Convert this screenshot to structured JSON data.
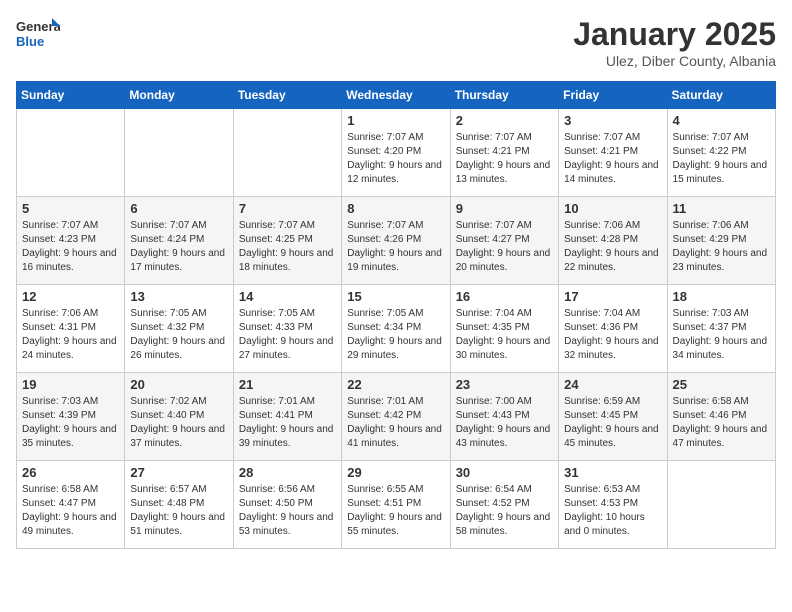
{
  "header": {
    "logo_general": "General",
    "logo_blue": "Blue",
    "month": "January 2025",
    "location": "Ulez, Diber County, Albania"
  },
  "weekdays": [
    "Sunday",
    "Monday",
    "Tuesday",
    "Wednesday",
    "Thursday",
    "Friday",
    "Saturday"
  ],
  "weeks": [
    [
      {
        "day": "",
        "info": ""
      },
      {
        "day": "",
        "info": ""
      },
      {
        "day": "",
        "info": ""
      },
      {
        "day": "1",
        "info": "Sunrise: 7:07 AM\nSunset: 4:20 PM\nDaylight: 9 hours and 12 minutes."
      },
      {
        "day": "2",
        "info": "Sunrise: 7:07 AM\nSunset: 4:21 PM\nDaylight: 9 hours and 13 minutes."
      },
      {
        "day": "3",
        "info": "Sunrise: 7:07 AM\nSunset: 4:21 PM\nDaylight: 9 hours and 14 minutes."
      },
      {
        "day": "4",
        "info": "Sunrise: 7:07 AM\nSunset: 4:22 PM\nDaylight: 9 hours and 15 minutes."
      }
    ],
    [
      {
        "day": "5",
        "info": "Sunrise: 7:07 AM\nSunset: 4:23 PM\nDaylight: 9 hours and 16 minutes."
      },
      {
        "day": "6",
        "info": "Sunrise: 7:07 AM\nSunset: 4:24 PM\nDaylight: 9 hours and 17 minutes."
      },
      {
        "day": "7",
        "info": "Sunrise: 7:07 AM\nSunset: 4:25 PM\nDaylight: 9 hours and 18 minutes."
      },
      {
        "day": "8",
        "info": "Sunrise: 7:07 AM\nSunset: 4:26 PM\nDaylight: 9 hours and 19 minutes."
      },
      {
        "day": "9",
        "info": "Sunrise: 7:07 AM\nSunset: 4:27 PM\nDaylight: 9 hours and 20 minutes."
      },
      {
        "day": "10",
        "info": "Sunrise: 7:06 AM\nSunset: 4:28 PM\nDaylight: 9 hours and 22 minutes."
      },
      {
        "day": "11",
        "info": "Sunrise: 7:06 AM\nSunset: 4:29 PM\nDaylight: 9 hours and 23 minutes."
      }
    ],
    [
      {
        "day": "12",
        "info": "Sunrise: 7:06 AM\nSunset: 4:31 PM\nDaylight: 9 hours and 24 minutes."
      },
      {
        "day": "13",
        "info": "Sunrise: 7:05 AM\nSunset: 4:32 PM\nDaylight: 9 hours and 26 minutes."
      },
      {
        "day": "14",
        "info": "Sunrise: 7:05 AM\nSunset: 4:33 PM\nDaylight: 9 hours and 27 minutes."
      },
      {
        "day": "15",
        "info": "Sunrise: 7:05 AM\nSunset: 4:34 PM\nDaylight: 9 hours and 29 minutes."
      },
      {
        "day": "16",
        "info": "Sunrise: 7:04 AM\nSunset: 4:35 PM\nDaylight: 9 hours and 30 minutes."
      },
      {
        "day": "17",
        "info": "Sunrise: 7:04 AM\nSunset: 4:36 PM\nDaylight: 9 hours and 32 minutes."
      },
      {
        "day": "18",
        "info": "Sunrise: 7:03 AM\nSunset: 4:37 PM\nDaylight: 9 hours and 34 minutes."
      }
    ],
    [
      {
        "day": "19",
        "info": "Sunrise: 7:03 AM\nSunset: 4:39 PM\nDaylight: 9 hours and 35 minutes."
      },
      {
        "day": "20",
        "info": "Sunrise: 7:02 AM\nSunset: 4:40 PM\nDaylight: 9 hours and 37 minutes."
      },
      {
        "day": "21",
        "info": "Sunrise: 7:01 AM\nSunset: 4:41 PM\nDaylight: 9 hours and 39 minutes."
      },
      {
        "day": "22",
        "info": "Sunrise: 7:01 AM\nSunset: 4:42 PM\nDaylight: 9 hours and 41 minutes."
      },
      {
        "day": "23",
        "info": "Sunrise: 7:00 AM\nSunset: 4:43 PM\nDaylight: 9 hours and 43 minutes."
      },
      {
        "day": "24",
        "info": "Sunrise: 6:59 AM\nSunset: 4:45 PM\nDaylight: 9 hours and 45 minutes."
      },
      {
        "day": "25",
        "info": "Sunrise: 6:58 AM\nSunset: 4:46 PM\nDaylight: 9 hours and 47 minutes."
      }
    ],
    [
      {
        "day": "26",
        "info": "Sunrise: 6:58 AM\nSunset: 4:47 PM\nDaylight: 9 hours and 49 minutes."
      },
      {
        "day": "27",
        "info": "Sunrise: 6:57 AM\nSunset: 4:48 PM\nDaylight: 9 hours and 51 minutes."
      },
      {
        "day": "28",
        "info": "Sunrise: 6:56 AM\nSunset: 4:50 PM\nDaylight: 9 hours and 53 minutes."
      },
      {
        "day": "29",
        "info": "Sunrise: 6:55 AM\nSunset: 4:51 PM\nDaylight: 9 hours and 55 minutes."
      },
      {
        "day": "30",
        "info": "Sunrise: 6:54 AM\nSunset: 4:52 PM\nDaylight: 9 hours and 58 minutes."
      },
      {
        "day": "31",
        "info": "Sunrise: 6:53 AM\nSunset: 4:53 PM\nDaylight: 10 hours and 0 minutes."
      },
      {
        "day": "",
        "info": ""
      }
    ]
  ]
}
